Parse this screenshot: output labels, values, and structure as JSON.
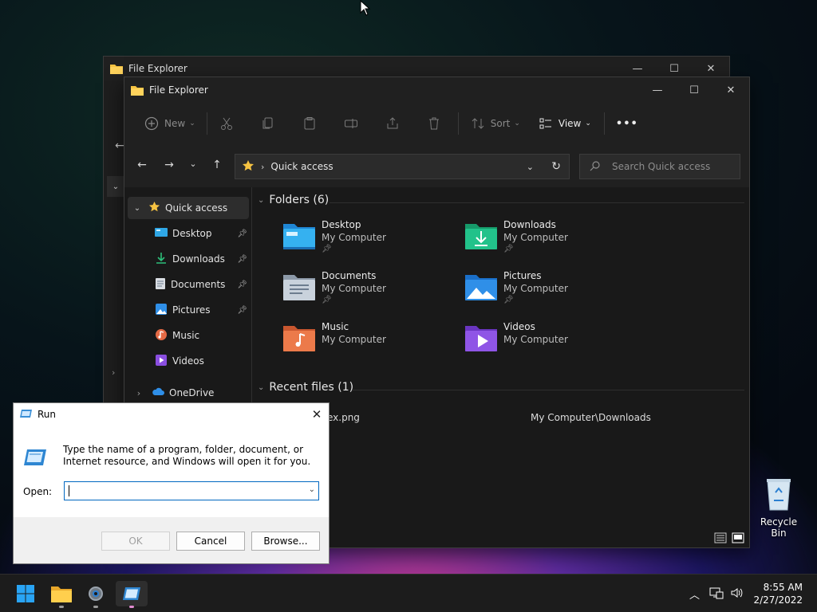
{
  "back_window": {
    "title": "File Explorer"
  },
  "explorer": {
    "title": "File Explorer",
    "toolbar": {
      "new_label": "New",
      "sort_label": "Sort",
      "view_label": "View",
      "more_label": "•••"
    },
    "address": {
      "crumb": "Quick access"
    },
    "search": {
      "placeholder": "Search Quick access"
    },
    "nav": {
      "quick_access": "Quick access",
      "items": [
        {
          "label": "Desktop",
          "pinned": true
        },
        {
          "label": "Downloads",
          "pinned": true
        },
        {
          "label": "Documents",
          "pinned": true
        },
        {
          "label": "Pictures",
          "pinned": true
        },
        {
          "label": "Music",
          "pinned": false
        },
        {
          "label": "Videos",
          "pinned": false
        }
      ],
      "onedrive": "OneDrive"
    },
    "folders_header": "Folders (6)",
    "folders": [
      {
        "name": "Desktop",
        "location": "My Computer",
        "pinned": true,
        "icon": "desktop-folder-icon"
      },
      {
        "name": "Downloads",
        "location": "My Computer",
        "pinned": true,
        "icon": "downloads-folder-icon"
      },
      {
        "name": "Documents",
        "location": "My Computer",
        "pinned": true,
        "icon": "documents-folder-icon"
      },
      {
        "name": "Pictures",
        "location": "My Computer",
        "pinned": true,
        "icon": "pictures-folder-icon"
      },
      {
        "name": "Music",
        "location": "My Computer",
        "pinned": false,
        "icon": "music-folder-icon"
      },
      {
        "name": "Videos",
        "location": "My Computer",
        "pinned": false,
        "icon": "videos-folder-icon"
      }
    ],
    "recent_header": "Recent files (1)",
    "recent": [
      {
        "name_visible": "ex.png",
        "path": "My Computer\\Downloads"
      }
    ]
  },
  "run_dialog": {
    "title": "Run",
    "description": "Type the name of a program, folder, document, or Internet resource, and Windows will open it for you.",
    "open_label": "Open:",
    "open_value": "",
    "ok_label": "OK",
    "cancel_label": "Cancel",
    "browse_label": "Browse..."
  },
  "desktop": {
    "recycle_bin_label": "Recycle Bin"
  },
  "taskbar": {
    "time": "8:55 AM",
    "date": "2/27/2022",
    "apps": [
      "start-button",
      "file-explorer",
      "settings",
      "run"
    ]
  },
  "colors": {
    "accent": "#0067c0",
    "folder_yellow": "#f6c342",
    "dark_bg": "#191919"
  }
}
